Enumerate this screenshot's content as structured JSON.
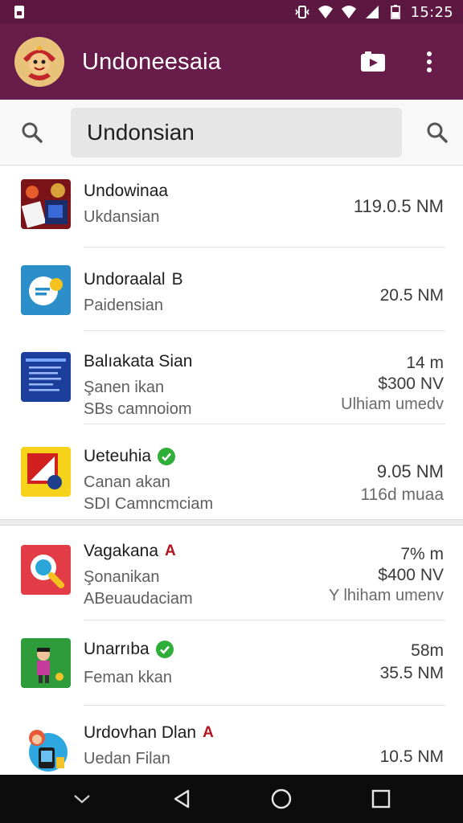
{
  "status_bar": {
    "time": "15:25",
    "icons": [
      "sim-icon",
      "vibrate-icon",
      "wifi-icon",
      "signal-icon",
      "signal-icon",
      "battery-icon"
    ]
  },
  "app_bar": {
    "title": "Undoneesaia",
    "logo_icon": "mascot-logo-icon",
    "actions": [
      "video-icon",
      "more-vert-icon"
    ],
    "color": "#671c4a"
  },
  "search": {
    "value": "Undonsian",
    "placeholder": ""
  },
  "items": [
    {
      "title": "Undowinaa",
      "subtitle": "Ukdansian",
      "subtitle2": "",
      "meta1": "119.0.5 NM",
      "meta2": "",
      "meta3": "",
      "badge": "",
      "badge_text": "",
      "thumb_icon": "game-app-icon"
    },
    {
      "title": "Undoraalal",
      "subtitle": "Paidensian",
      "subtitle2": "",
      "meta1": "20.5 NM",
      "meta2": "",
      "meta3": "",
      "badge": "",
      "badge_text": "B",
      "thumb_icon": "chat-app-icon"
    },
    {
      "title": "Balıakata Sian",
      "subtitle": "Şanen ikan",
      "subtitle2": "SBs camnoiom",
      "meta1": "14 m",
      "meta2": "$300 NV",
      "meta3": "Ulhiam umedv",
      "badge": "",
      "badge_text": "",
      "thumb_icon": "document-app-icon"
    },
    {
      "title": "Ueteuhia",
      "subtitle": "Canan akan",
      "subtitle2": "SDI Camncmciam",
      "meta1": "9.05 NM",
      "meta2": "116d muaa",
      "meta3": "",
      "badge": "verified",
      "badge_text": "",
      "thumb_icon": "puzzle-app-icon"
    },
    {
      "title": "Vagakana",
      "subtitle": "Şonanikan",
      "subtitle2": "ABeuaudaciam",
      "meta1": "7% m",
      "meta2": "$400 NV",
      "meta3": "Y lhiham umenv",
      "badge": "",
      "badge_text": "A",
      "thumb_icon": "search-app-icon"
    },
    {
      "title": "Unarrıba",
      "subtitle": "Feman kkan",
      "subtitle2": "",
      "meta1": "58m",
      "meta2": "35.5 NM",
      "meta3": "",
      "badge": "verified",
      "badge_text": "",
      "thumb_icon": "character-app-icon"
    },
    {
      "title": "Urdovhan Dlan",
      "subtitle": "Uedan Filan",
      "subtitle2": "",
      "meta1": "10.5 NM",
      "meta2": "",
      "meta3": "",
      "badge": "",
      "badge_text": "A",
      "thumb_icon": "avatar-app-icon"
    }
  ],
  "colors": {
    "status_bar": "#5c1840",
    "app_bar": "#671c4a",
    "verified": "#2fae3a",
    "badge_red": "#b3131f"
  },
  "nav": {
    "icons": [
      "nav-down-icon",
      "nav-back-icon",
      "nav-home-icon",
      "nav-recents-icon"
    ]
  }
}
